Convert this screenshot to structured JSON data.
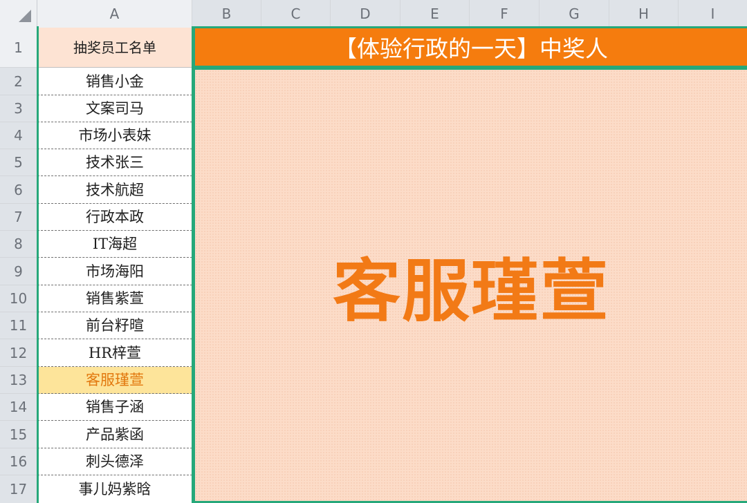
{
  "columns": [
    "A",
    "B",
    "C",
    "D",
    "E",
    "F",
    "G",
    "H",
    "I"
  ],
  "rows": [
    "1",
    "2",
    "3",
    "4",
    "5",
    "6",
    "7",
    "8",
    "9",
    "10",
    "11",
    "12",
    "13",
    "14",
    "15",
    "16",
    "17"
  ],
  "list_header": "抽奖员工名单",
  "employees": [
    "销售小金",
    "文案司马",
    "市场小表妹",
    "技术张三",
    "技术航超",
    "行政本政",
    "IT海超",
    "市场海阳",
    "销售紫萱",
    "前台籽暄",
    "HR梓萱",
    "客服瑾萱",
    "销售子涵",
    "产品紫函",
    "刺头德泽",
    "事儿妈紫晗"
  ],
  "title": "【体验行政的一天】中奖人",
  "winner": "客服瑾萱",
  "colors": {
    "title_bg": "#f57c0e",
    "winner_text": "#f27a16",
    "highlight": "#fde49a",
    "selection_border": "#26a87a"
  }
}
